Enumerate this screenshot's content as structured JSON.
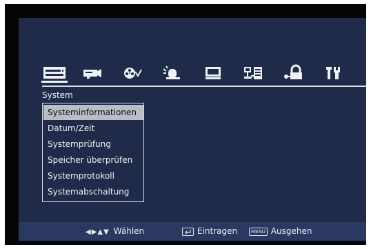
{
  "icons": [
    {
      "name": "system-icon",
      "selected": true
    },
    {
      "name": "camera-icon",
      "selected": false
    },
    {
      "name": "recording-icon",
      "selected": false
    },
    {
      "name": "alarm-icon",
      "selected": false
    },
    {
      "name": "display-icon",
      "selected": false
    },
    {
      "name": "network-icon",
      "selected": false
    },
    {
      "name": "user-key-icon",
      "selected": false
    },
    {
      "name": "tools-icon",
      "selected": false
    }
  ],
  "section_title": "System",
  "menu": {
    "selected_index": 0,
    "items": [
      {
        "label": "Systeminformationen"
      },
      {
        "label": "Datum/Zeit"
      },
      {
        "label": "Systemprüfung"
      },
      {
        "label": "Speicher überprüfen"
      },
      {
        "label": "Systemprotokoll"
      },
      {
        "label": "Systemabschaltung"
      }
    ]
  },
  "footer": {
    "navigate_symbols": "◀▶▲▼",
    "navigate_label": "Wählen",
    "enter_label": "Eintragen",
    "menu_key": "MENU",
    "menu_label": "Ausgehen"
  },
  "colors": {
    "screen_background": "#1f2b48",
    "footer_background": "#2b3960",
    "selected_item": "#b9bdc6",
    "text": "#eef1f7"
  }
}
